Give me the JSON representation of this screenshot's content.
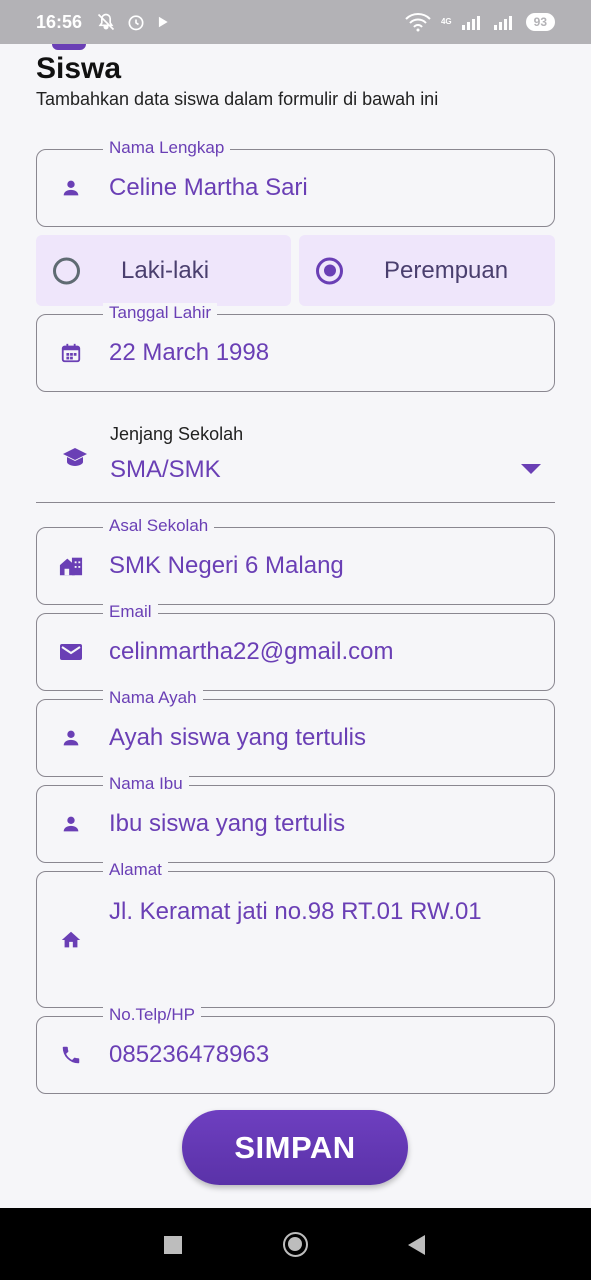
{
  "status_bar": {
    "time": "16:56",
    "network": "4G",
    "battery": "93",
    "icons": [
      "mute-bell-icon",
      "alarm-icon",
      "play-store-icon",
      "wifi-icon",
      "signal-icon",
      "signal-icon-2",
      "battery-icon"
    ]
  },
  "header": {
    "title": "Siswa",
    "subtitle": "Tambahkan data siswa dalam formulir di bawah ini"
  },
  "form": {
    "nama_lengkap": {
      "label": "Nama Lengkap",
      "value": "Celine Martha Sari",
      "icon": "person-icon"
    },
    "gender": {
      "options": [
        {
          "label": "Laki-laki",
          "selected": false
        },
        {
          "label": "Perempuan",
          "selected": true
        }
      ]
    },
    "tanggal_lahir": {
      "label": "Tanggal Lahir",
      "value": "22 March 1998",
      "icon": "calendar-icon"
    },
    "jenjang_sekolah": {
      "label": "Jenjang Sekolah",
      "value": "SMA/SMK",
      "icon": "school-icon"
    },
    "asal_sekolah": {
      "label": "Asal Sekolah",
      "value": "SMK Negeri 6 Malang",
      "icon": "building-icon"
    },
    "email": {
      "label": "Email",
      "value": "celinmartha22@gmail.com",
      "icon": "email-icon"
    },
    "nama_ayah": {
      "label": "Nama Ayah",
      "value": "Ayah siswa yang tertulis",
      "icon": "person-icon"
    },
    "nama_ibu": {
      "label": "Nama Ibu",
      "value": "Ibu siswa yang tertulis",
      "icon": "person-icon"
    },
    "alamat": {
      "label": "Alamat",
      "value": "Jl. Keramat jati no.98 RT.01 RW.01",
      "icon": "home-icon"
    },
    "no_telp": {
      "label": "No.Telp/HP",
      "value": "085236478963",
      "icon": "phone-icon"
    }
  },
  "actions": {
    "save_label": "SIMPAN"
  },
  "colors": {
    "accent": "#6a3fb5",
    "radio_bg": "#efe6fb",
    "background": "#f6f6f9",
    "status_bar": "#b3b2b6"
  }
}
